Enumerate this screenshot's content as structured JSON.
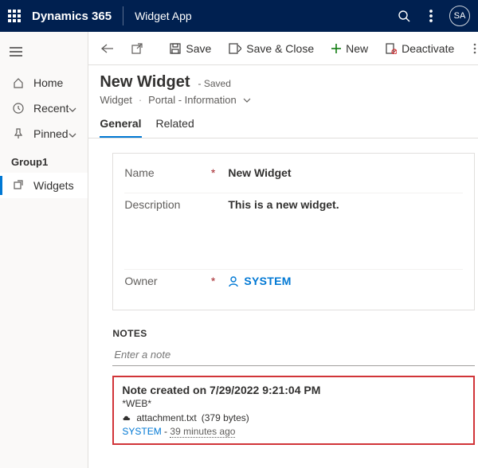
{
  "topbar": {
    "brand": "Dynamics 365",
    "app": "Widget App",
    "avatar": "SA"
  },
  "sidebar": {
    "home": "Home",
    "recent": "Recent",
    "pinned": "Pinned",
    "group": "Group1",
    "widgets": "Widgets"
  },
  "commands": {
    "save": "Save",
    "saveclose": "Save & Close",
    "new": "New",
    "deactivate": "Deactivate"
  },
  "record": {
    "title": "New Widget",
    "status": "- Saved",
    "entity": "Widget",
    "form": "Portal - Information"
  },
  "tabs": {
    "general": "General",
    "related": "Related"
  },
  "fields": {
    "name_label": "Name",
    "name_value": "New Widget",
    "desc_label": "Description",
    "desc_value": "This is a new widget.",
    "owner_label": "Owner",
    "owner_value": "SYSTEM"
  },
  "notes": {
    "header": "NOTES",
    "placeholder": "Enter a note",
    "title": "Note created on 7/29/2022 9:21:04 PM",
    "subtitle": "*WEB*",
    "attachment_name": "attachment.txt",
    "attachment_size": "(379 bytes)",
    "author": "SYSTEM",
    "ago": "39 minutes ago"
  }
}
